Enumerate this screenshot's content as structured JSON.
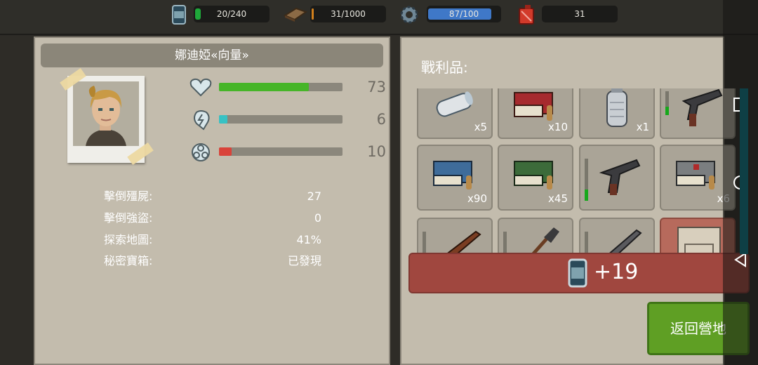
{
  "resources": [
    {
      "id": "food",
      "icon": "food-can-icon",
      "label": "20/240",
      "fraction": 0.083,
      "color": "#1fa83a"
    },
    {
      "id": "wood",
      "icon": "wood-plank-icon",
      "label": "31/1000",
      "fraction": 0.031,
      "color": "#d2801c"
    },
    {
      "id": "parts",
      "icon": "gear-icon",
      "label": "87/100",
      "fraction": 0.87,
      "color": "#3f78c8"
    },
    {
      "id": "fuel",
      "icon": "fuel-canister-icon",
      "label": "31",
      "fraction": 0,
      "color": "#d23a2a"
    }
  ],
  "character": {
    "name": "娜迪婭«向量»",
    "stats": [
      {
        "id": "health",
        "icon": "heart-icon",
        "value": "73",
        "fraction": 0.73,
        "color": "#46b528"
      },
      {
        "id": "energy",
        "icon": "lightning-icon",
        "value": "6",
        "fraction": 0.06,
        "color": "#38c2c4"
      },
      {
        "id": "radiation",
        "icon": "biohazard-icon",
        "value": "10",
        "fraction": 0.1,
        "color": "#d9433a"
      }
    ],
    "details": [
      {
        "key": "擊倒殭屍:",
        "value": "27"
      },
      {
        "key": "擊倒強盜:",
        "value": "0"
      },
      {
        "key": "探索地圖:",
        "value": "41%"
      },
      {
        "key": "秘密寶箱:",
        "value": "已發現"
      }
    ]
  },
  "loot": {
    "title": "戰利品:",
    "items": [
      {
        "name": "bandage-roll-icon",
        "qty": "x5"
      },
      {
        "name": "red-ammo-box-icon",
        "qty": "x10"
      },
      {
        "name": "grenade-canister-icon",
        "qty": "x1"
      },
      {
        "name": "revolver-icon",
        "qty": "",
        "durability": 0.3
      },
      {
        "name": "blue-ammo-box-icon",
        "qty": "x90"
      },
      {
        "name": "green-ammo-box-icon",
        "qty": "x45"
      },
      {
        "name": "pistol-icon",
        "qty": "",
        "durability": 0.3
      },
      {
        "name": "medkit-ammo-box-icon",
        "qty": "x6"
      },
      {
        "name": "rifle-icon",
        "qty": "",
        "durability": 0.4
      },
      {
        "name": "shovel-icon",
        "qty": "",
        "durability": 0
      },
      {
        "name": "shotgun-icon",
        "qty": "",
        "durability": 0
      },
      {
        "name": "mre-bag-icon",
        "qty": ""
      }
    ],
    "reward": {
      "icon": "food-can-icon",
      "text": "+19"
    }
  },
  "buttons": {
    "return": "返回營地"
  },
  "nav": {
    "icons": [
      "square-nav-icon",
      "circle-nav-icon",
      "triangle-back-icon"
    ]
  }
}
